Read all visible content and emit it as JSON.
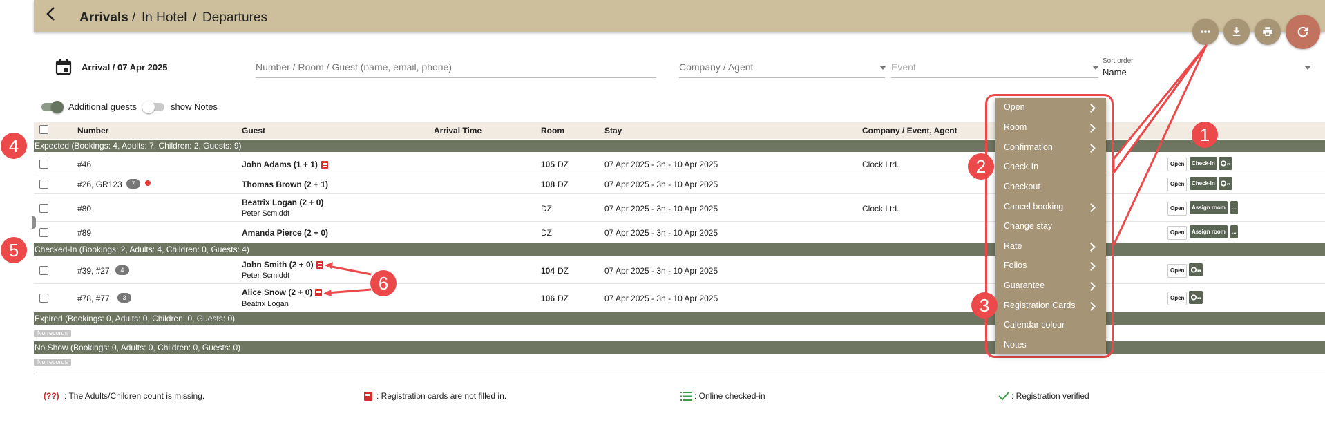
{
  "header": {
    "title_arrivals": "Arrivals",
    "sep1": "/",
    "title_in_hotel": "In Hotel",
    "sep2": "/",
    "title_departures": "Departures",
    "back_icon": "chevron-left-icon",
    "actions": [
      "more-icon",
      "download-icon",
      "print-icon",
      "refresh-icon"
    ]
  },
  "filters": {
    "date_label": "Arrival / 07 Apr 2025",
    "search_placeholder": "Number / Room / Guest (name, email, phone)",
    "company_placeholder": "Company / Agent",
    "event_placeholder": "Event",
    "sort_label": "Sort order",
    "sort_value": "Name"
  },
  "toggles": {
    "additional_guests": "Additional guests",
    "additional_guests_on": true,
    "show_notes": "show Notes",
    "show_notes_on": false
  },
  "table": {
    "columns": {
      "number": "Number",
      "guest": "Guest",
      "arrival_time": "Arrival Time",
      "room": "Room",
      "stay": "Stay",
      "company": "Company / Event, Agent"
    },
    "groups": {
      "expected": "Expected (Bookings: 4, Adults: 7, Children: 2, Guests: 9)",
      "checked_in": "Checked-In (Bookings: 2, Adults: 4, Children: 0, Guests: 4)",
      "expired": "Expired (Bookings: 0, Adults: 0, Children: 0, Guests: 0)",
      "no_show": "No Show (Bookings: 0, Adults: 0, Children: 0, Guests: 0)"
    },
    "rows": [
      {
        "number": "#46",
        "guest": "John Adams (1 + 1)",
        "room_no": "105",
        "room_type": "DZ",
        "stay": "07 Apr 2025 - 3n - 10 Apr 2025",
        "company": "Clock Ltd."
      },
      {
        "number": "#26, GR123",
        "badge": "7",
        "guest": "Thomas Brown (2 + 1)",
        "room_no": "108",
        "room_type": "DZ",
        "stay": "07 Apr 2025 - 3n - 10 Apr 2025",
        "company": ""
      },
      {
        "number": "#80",
        "guest": "Beatrix Logan (2 + 0)",
        "sub_guest": "Peter Scmiddt",
        "room_no": "",
        "room_type": "DZ",
        "stay": "07 Apr 2025 - 3n - 10 Apr 2025",
        "company": "Clock Ltd."
      },
      {
        "number": "#89",
        "guest": "Amanda Pierce (2 + 0)",
        "room_no": "",
        "room_type": "DZ",
        "stay": "07 Apr 2025 - 3n - 10 Apr 2025",
        "company": ""
      },
      {
        "number": "#39, #27",
        "badge": "4",
        "guest": "John Smith (2 + 0)",
        "sub_guest": "Peter Scmiddt",
        "room_no": "104",
        "room_type": "DZ",
        "stay": "07 Apr 2025 - 3n - 10 Apr 2025",
        "company": ""
      },
      {
        "number": "#78, #77",
        "badge": "3",
        "guest": "Alice Snow (2 + 0)",
        "sub_guest": "Beatrix Logan",
        "room_no": "106",
        "room_type": "DZ",
        "stay": "07 Apr 2025 - 3n - 10 Apr 2025",
        "company": ""
      }
    ],
    "no_records": "No records",
    "buttons": {
      "open": "Open",
      "check_in": "Check-In",
      "assign_room": "Assign room",
      "more": "..."
    }
  },
  "legend": {
    "missing_marker": "(??)",
    "missing": ": The Adults/Children count is missing.",
    "reg_cards": ": Registration cards are not filled in.",
    "online": ": Online checked-in",
    "verified": ": Registration verified"
  },
  "context_menu": {
    "items": [
      {
        "label": "Open",
        "submenu": true
      },
      {
        "label": "Room",
        "submenu": true
      },
      {
        "label": "Confirmation",
        "submenu": true
      },
      {
        "label": "Check-In",
        "submenu": false
      },
      {
        "label": "Checkout",
        "submenu": false
      },
      {
        "label": "Cancel booking",
        "submenu": true
      },
      {
        "label": "Change stay",
        "submenu": false
      },
      {
        "label": "Rate",
        "submenu": true
      },
      {
        "label": "Folios",
        "submenu": true
      },
      {
        "label": "Guarantee",
        "submenu": true
      },
      {
        "label": "Registration Cards",
        "submenu": true
      },
      {
        "label": "Calendar colour",
        "submenu": false
      },
      {
        "label": "Notes",
        "submenu": false
      }
    ]
  },
  "annotations": {
    "b1": "1",
    "b2": "2",
    "b3": "3",
    "b4": "4",
    "b5": "5",
    "b6": "6",
    "color": "#ec4a4a"
  },
  "colors": {
    "header": "#cdbf9c",
    "group_bar": "#6e7560",
    "menu": "#a59476",
    "refresh": "#c2735f",
    "action_button": "#5b6554"
  }
}
